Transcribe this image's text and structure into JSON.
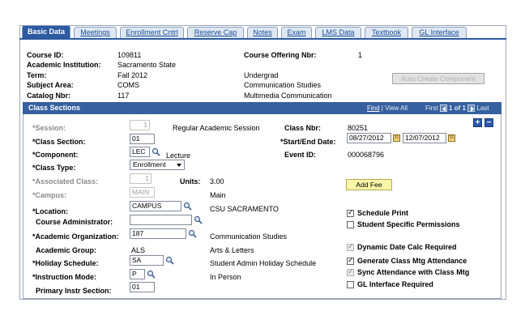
{
  "tabs": [
    {
      "label": "Basic Data",
      "active": true
    },
    {
      "label": "Meetings"
    },
    {
      "label": "Enrollment Cntrl"
    },
    {
      "label": "Reserve Cap"
    },
    {
      "label": "Notes"
    },
    {
      "label": "Exam"
    },
    {
      "label": "LMS Data"
    },
    {
      "label": "Textbook"
    },
    {
      "label": "GL Interface"
    }
  ],
  "header": {
    "course_id_label": "Course ID:",
    "course_id": "109811",
    "offering_label": "Course Offering Nbr:",
    "offering": "1",
    "institution_label": "Academic Institution:",
    "institution": "Sacramento State",
    "term_label": "Term:",
    "term": "Fall 2012",
    "career": "Undergrad",
    "subject_label": "Subject Area:",
    "subject": "COMS",
    "subject_desc": "Communication Studies",
    "catalog_label": "Catalog Nbr:",
    "catalog": "117",
    "catalog_desc": "Multimedia Communication",
    "auto_create_label": "Auto Create Component"
  },
  "section": {
    "title": "Class Sections",
    "find": "Find",
    "view_all": "View All",
    "first": "First",
    "range": "1 of 1",
    "last": "Last"
  },
  "fields": {
    "session_label": "*Session:",
    "session": "1",
    "session_desc": "Regular Academic Session",
    "class_nbr_label": "Class Nbr:",
    "class_nbr": "80251",
    "class_section_label": "*Class Section:",
    "class_section": "01",
    "start_end_label": "*Start/End Date:",
    "start_date": "08/27/2012",
    "end_date": "12/07/2012",
    "component_label": "*Component:",
    "component": "LEC",
    "component_desc": "Lecture",
    "event_id_label": "Event ID:",
    "event_id": "000068796",
    "class_type_label": "*Class Type:",
    "class_type": "Enrollment",
    "assoc_class_label": "*Associated Class:",
    "assoc_class": "1",
    "units_label": "Units:",
    "units": "3.00",
    "add_fee_label": "Add Fee",
    "campus_label": "*Campus:",
    "campus": "MAIN",
    "campus_desc": "Main",
    "location_label": "*Location:",
    "location": "CAMPUS",
    "location_desc": "CSU SACRAMENTO",
    "course_admin_label": "Course Administrator:",
    "course_admin": "",
    "acad_org_label": "*Academic Organization:",
    "acad_org": "187",
    "acad_org_desc": "Communication Studies",
    "acad_group_label": "Academic Group:",
    "acad_group": "ALS",
    "acad_group_desc": "Arts & Letters",
    "holiday_label": "*Holiday Schedule:",
    "holiday": "SA",
    "holiday_desc": "Student Admin Holiday Schedule",
    "instr_mode_label": "*Instruction Mode:",
    "instr_mode": "P",
    "instr_mode_desc": "In Person",
    "primary_label": "Primary Instr Section:",
    "primary": "01"
  },
  "checkboxes": [
    {
      "label": "Schedule Print",
      "checked": true,
      "disabled": false
    },
    {
      "label": "Student Specific Permissions",
      "checked": false,
      "disabled": false
    },
    {
      "label": "Dynamic Date Calc Required",
      "checked": true,
      "disabled": true
    },
    {
      "label": "Generate Class Mtg Attendance",
      "checked": true,
      "disabled": false
    },
    {
      "label": "Sync Attendance with Class Mtg",
      "checked": true,
      "disabled": true
    },
    {
      "label": "GL Interface Required",
      "checked": false,
      "disabled": false
    }
  ],
  "colors": {
    "tab_active": "#2e5aa1",
    "section_header": "#36609f",
    "button_yellow": "#fbf6a8"
  }
}
